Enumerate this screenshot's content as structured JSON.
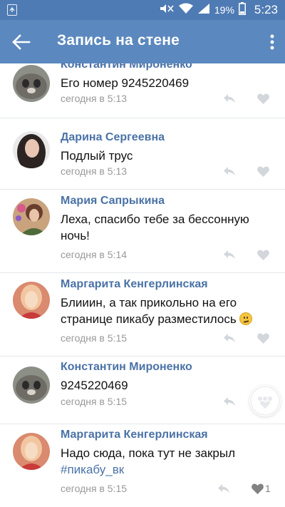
{
  "status_bar": {
    "battery_percent": "19%",
    "time": "5:23"
  },
  "app_bar": {
    "title": "Запись на стене"
  },
  "comments": [
    {
      "author": "Константин Мироненко",
      "text": "Его номер 9245220469",
      "time": "сегодня в 5:13"
    },
    {
      "author": "Дарина Сергеевна",
      "text": "Подлый трус",
      "time": "сегодня в 5:13"
    },
    {
      "author": "Мария Сапрыкина",
      "text": "Леха, спасибо тебе за бессонную ночь!",
      "time": "сегодня в 5:14"
    },
    {
      "author": "Маргарита Кенгерлинская",
      "text": "Блииин, а так прикольно на его странице пикабу разместилось",
      "emoji": "confused-face",
      "time": "сегодня в 5:15"
    },
    {
      "author": "Константин Мироненко",
      "text": "9245220469",
      "time": "сегодня в 5:15"
    },
    {
      "author": "Маргарита Кенгерлинская",
      "text": "Надо сюда, пока тут не закрыл",
      "hashtag": "#пикабу_вк",
      "time": "сегодня в 5:15",
      "likes": "1"
    }
  ],
  "colors": {
    "status_bar": "#4f7bb4",
    "app_bar": "#5b88be",
    "author": "#4a72a6",
    "meta": "#999999"
  },
  "icons": {
    "back": "arrow-left-icon",
    "menu": "more-vertical-icon",
    "reply": "reply-icon",
    "like": "heart-icon"
  }
}
